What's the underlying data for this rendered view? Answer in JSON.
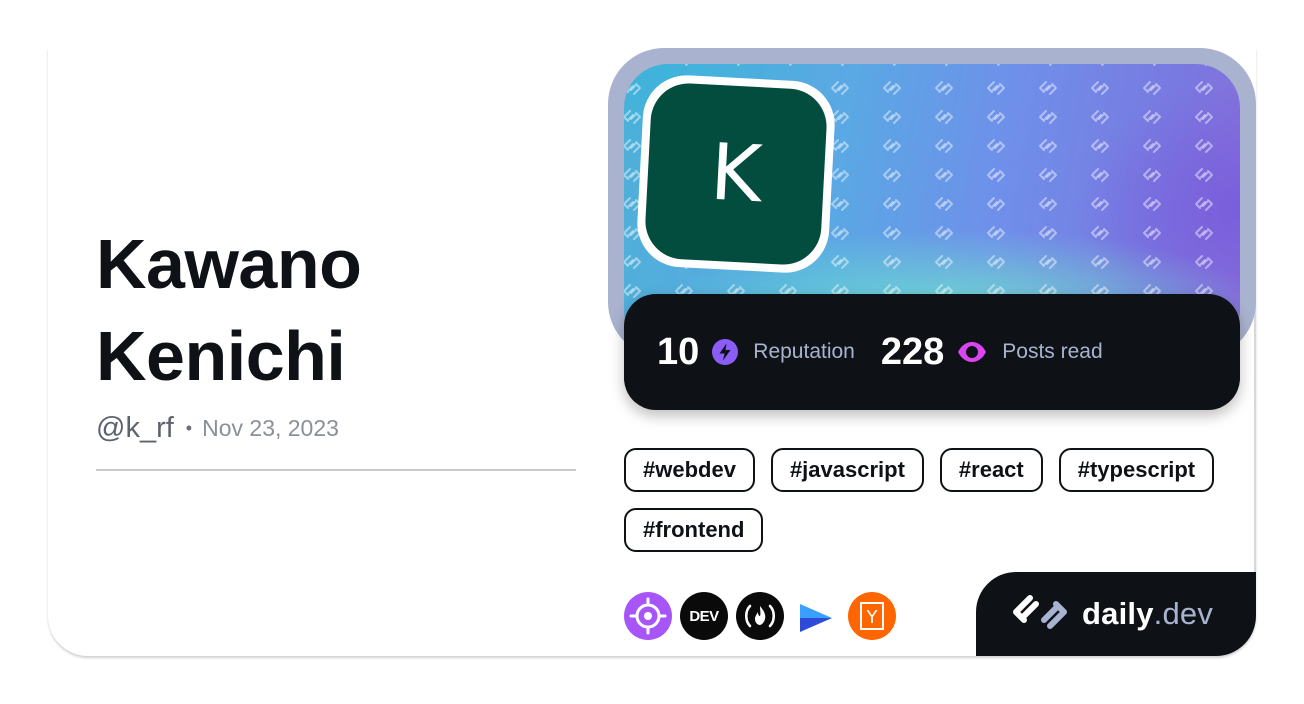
{
  "profile": {
    "first_name": "Kawano",
    "last_name": "Kenichi",
    "handle": "@k_rf",
    "separator": "•",
    "joined": "Nov 23, 2023",
    "avatar_initial": "K",
    "avatar_color": "#034d3e"
  },
  "stats": {
    "reputation_value": "10",
    "reputation_label": "Reputation",
    "reputation_icon": "lightning-icon",
    "posts_value": "228",
    "posts_label": "Posts read",
    "posts_icon": "eye-icon"
  },
  "tags": [
    "#webdev",
    "#javascript",
    "#react",
    "#typescript",
    "#frontend"
  ],
  "sources": [
    {
      "name": "target-source-icon",
      "label": ""
    },
    {
      "name": "dev-to-icon",
      "label": "DEV"
    },
    {
      "name": "freecodecamp-icon",
      "label": ""
    },
    {
      "name": "arrow-source-icon",
      "label": ""
    },
    {
      "name": "hacker-news-icon",
      "label": "Y"
    }
  ],
  "brand": {
    "name": "daily",
    "suffix": ".dev"
  },
  "colors": {
    "dark": "#0e1217",
    "reputation_accent": "#8b5cf6",
    "posts_accent": "#d946ef",
    "muted": "#a8b3cf"
  }
}
